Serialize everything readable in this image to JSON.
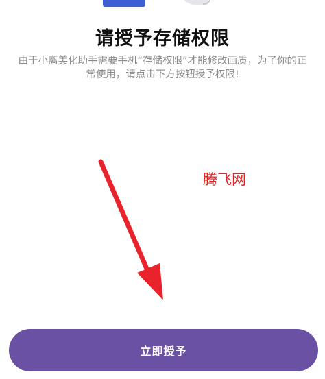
{
  "permission_page": {
    "title": "请授予存储权限",
    "description": "由于小离美化助手需要手机“存储权限”才能修改画质，为了你的正常使用，请点击下方按钮授予权限!",
    "watermark": "腾飞网",
    "grant_button_label": "立即授予"
  },
  "colors": {
    "button_background": "#6a51a3",
    "arrow": "#e8232b",
    "watermark": "#e02424",
    "illustration_blue": "#3d5fd6"
  },
  "icons": {
    "arrow": "red-arrow-pointing-down-icon"
  }
}
